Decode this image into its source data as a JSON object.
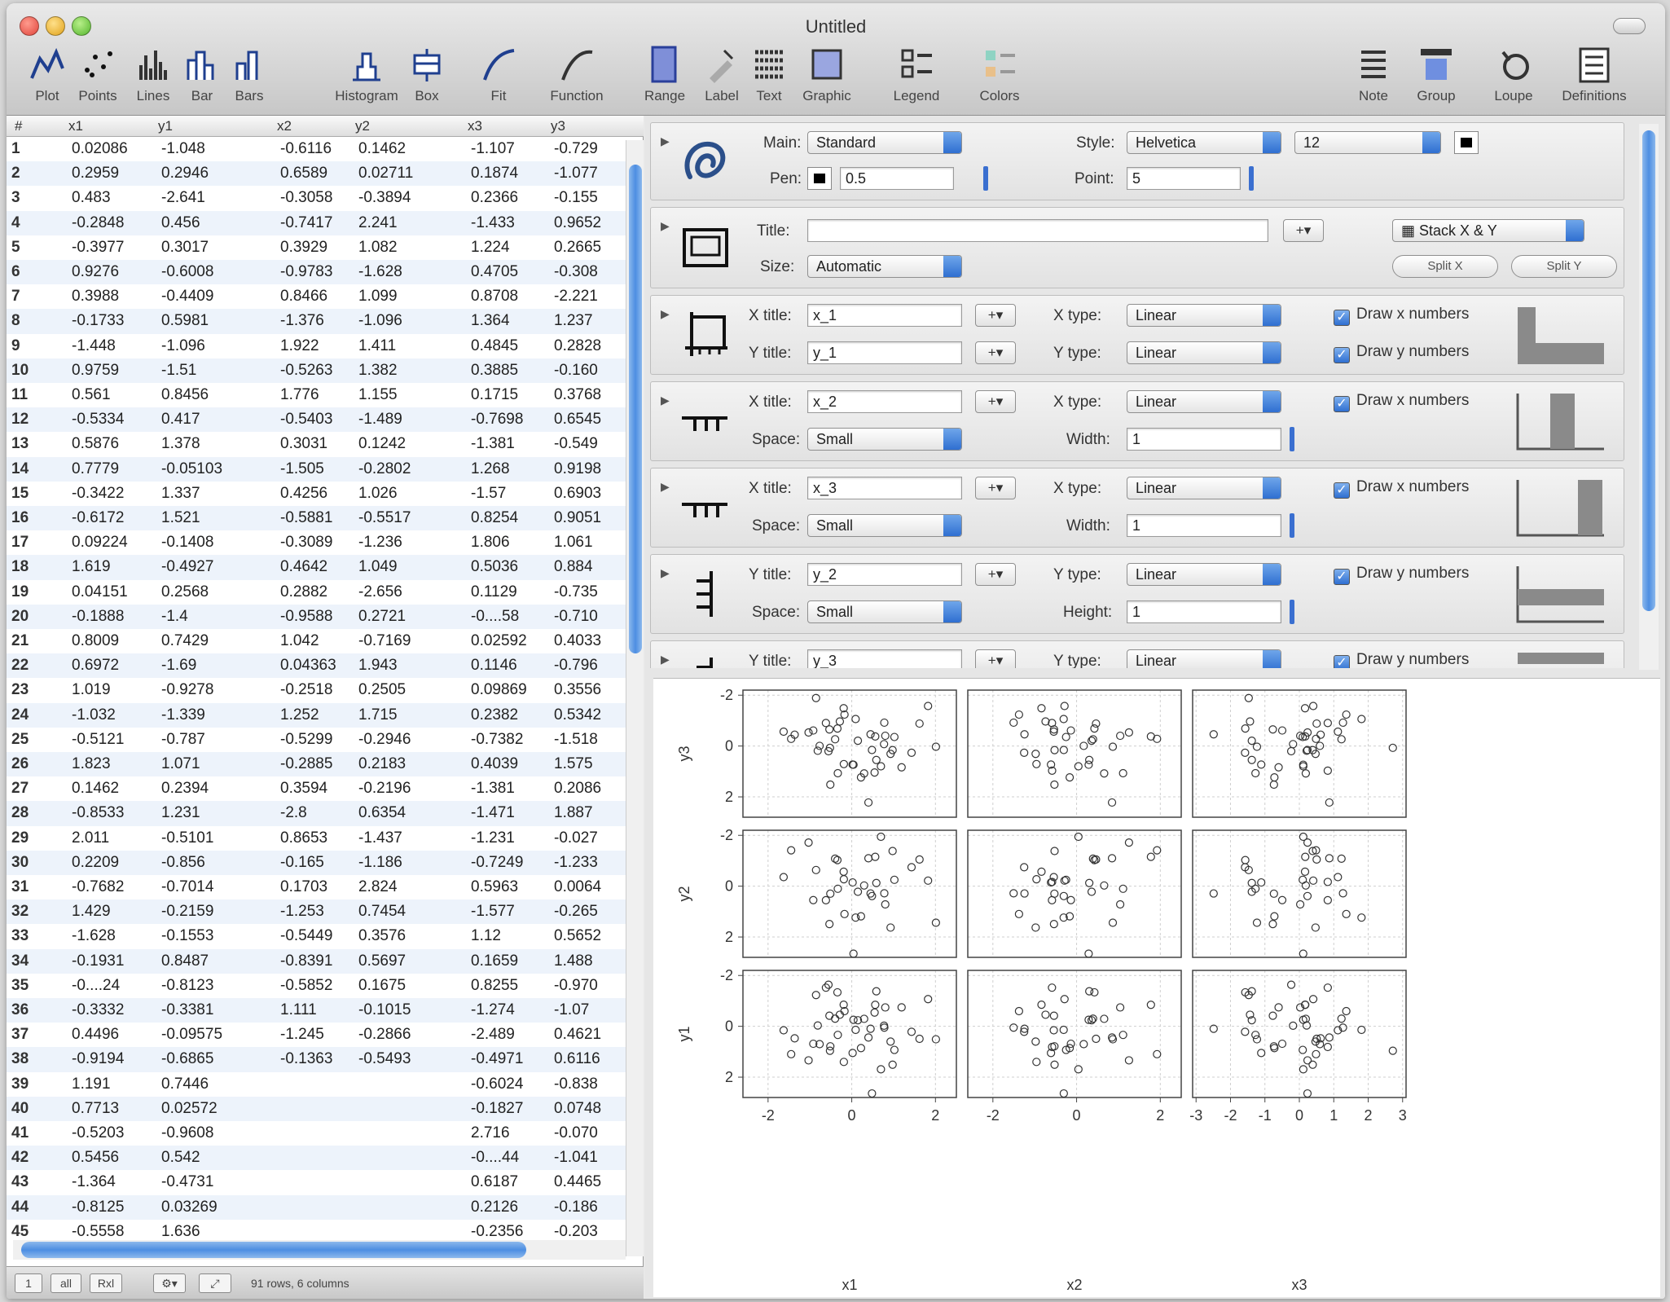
{
  "window": {
    "title": "Untitled"
  },
  "toolbar": [
    {
      "label": "Plot",
      "icon": "plot-icon"
    },
    {
      "label": "Points",
      "icon": "points-icon"
    },
    {
      "label": "Lines",
      "icon": "lines-icon"
    },
    {
      "label": "Bar",
      "icon": "bar-icon"
    },
    {
      "label": "Bars",
      "icon": "bars-icon"
    },
    {
      "label": "Histogram",
      "icon": "histogram-icon"
    },
    {
      "label": "Box",
      "icon": "box-icon"
    },
    {
      "label": "Fit",
      "icon": "fit-icon"
    },
    {
      "label": "Function",
      "icon": "function-icon"
    },
    {
      "label": "Range",
      "icon": "range-icon"
    },
    {
      "label": "Label",
      "icon": "label-icon"
    },
    {
      "label": "Text",
      "icon": "text-icon"
    },
    {
      "label": "Graphic",
      "icon": "graphic-icon"
    },
    {
      "label": "Legend",
      "icon": "legend-icon"
    },
    {
      "label": "Colors",
      "icon": "colors-icon"
    },
    {
      "label": "Note",
      "icon": "note-icon"
    },
    {
      "label": "Group",
      "icon": "group-icon"
    },
    {
      "label": "Loupe",
      "icon": "loupe-icon"
    },
    {
      "label": "Definitions",
      "icon": "definitions-icon"
    }
  ],
  "table": {
    "columns": [
      "#",
      "x1",
      "y1",
      "x2",
      "y2",
      "x3",
      "y3"
    ],
    "rows": [
      [
        "1",
        "0.02086",
        "-1.048",
        "-0.6116",
        "0.1462",
        "-1.107",
        "-0.729"
      ],
      [
        "2",
        "0.2959",
        "0.2946",
        "0.6589",
        "0.02711",
        "0.1874",
        "-1.077"
      ],
      [
        "3",
        "0.483",
        "-2.641",
        "-0.3058",
        "-0.3894",
        "0.2366",
        "-0.155"
      ],
      [
        "4",
        "-0.2848",
        "0.456",
        "-0.7417",
        "2.241",
        "-1.433",
        "0.9652"
      ],
      [
        "5",
        "-0.3977",
        "0.3017",
        "0.3929",
        "1.082",
        "1.224",
        "0.2665"
      ],
      [
        "6",
        "0.9276",
        "-0.6008",
        "-0.9783",
        "-1.628",
        "0.4705",
        "-0.308"
      ],
      [
        "7",
        "0.3988",
        "-0.4409",
        "0.8466",
        "1.099",
        "0.8708",
        "-2.221"
      ],
      [
        "8",
        "-0.1733",
        "0.5981",
        "-1.376",
        "-1.096",
        "1.364",
        "1.237"
      ],
      [
        "9",
        "-1.448",
        "-1.096",
        "1.922",
        "1.411",
        "0.4845",
        "0.2828"
      ],
      [
        "10",
        "0.9759",
        "-1.51",
        "-0.5263",
        "1.382",
        "0.3885",
        "-0.160"
      ],
      [
        "11",
        "0.561",
        "0.8456",
        "1.776",
        "1.155",
        "0.1715",
        "0.3768"
      ],
      [
        "12",
        "-0.5334",
        "0.417",
        "-0.5403",
        "-1.489",
        "-0.7698",
        "0.6545"
      ],
      [
        "13",
        "0.5876",
        "1.378",
        "0.3031",
        "0.1242",
        "-1.381",
        "-0.549"
      ],
      [
        "14",
        "0.7779",
        "-0.05103",
        "-1.505",
        "-0.2802",
        "1.268",
        "0.9198"
      ],
      [
        "15",
        "-0.3422",
        "1.337",
        "0.4256",
        "1.026",
        "-1.57",
        "0.6903"
      ],
      [
        "16",
        "-0.6172",
        "1.521",
        "-0.5881",
        "-0.5517",
        "0.8254",
        "0.9051"
      ],
      [
        "17",
        "0.09224",
        "-0.1408",
        "-0.3089",
        "-1.236",
        "1.806",
        "1.061"
      ],
      [
        "18",
        "1.619",
        "-0.4927",
        "0.4642",
        "1.049",
        "0.5036",
        "0.884"
      ],
      [
        "19",
        "0.04151",
        "0.2568",
        "0.2882",
        "-2.656",
        "0.1129",
        "-0.735"
      ],
      [
        "20",
        "-0.1888",
        "-1.4",
        "-0.9588",
        "0.2721",
        "-0....58",
        "-0.710"
      ],
      [
        "21",
        "0.8009",
        "0.7429",
        "1.042",
        "-0.7169",
        "0.02592",
        "0.4033"
      ],
      [
        "22",
        "0.6972",
        "-1.69",
        "0.04363",
        "1.943",
        "0.1146",
        "-0.796"
      ],
      [
        "23",
        "1.019",
        "-0.9278",
        "-0.2518",
        "0.2505",
        "0.09869",
        "0.3556"
      ],
      [
        "24",
        "-1.032",
        "-1.339",
        "1.252",
        "1.715",
        "0.2382",
        "0.5342"
      ],
      [
        "25",
        "-0.5121",
        "-0.787",
        "-0.5299",
        "-0.2946",
        "-0.7382",
        "-1.518"
      ],
      [
        "26",
        "1.823",
        "1.071",
        "-0.2885",
        "0.2183",
        "0.4039",
        "1.575"
      ],
      [
        "27",
        "0.1462",
        "0.2394",
        "0.3594",
        "-0.2196",
        "-1.381",
        "0.2086"
      ],
      [
        "28",
        "-0.8533",
        "1.231",
        "-2.8",
        "0.6354",
        "-1.471",
        "1.887"
      ],
      [
        "29",
        "2.011",
        "-0.5101",
        "0.8653",
        "-1.437",
        "-1.231",
        "-0.027"
      ],
      [
        "30",
        "0.2209",
        "-0.856",
        "-0.165",
        "-1.186",
        "-0.7249",
        "-1.233"
      ],
      [
        "31",
        "-0.7682",
        "-0.7014",
        "0.1703",
        "2.824",
        "0.5963",
        "0.0064"
      ],
      [
        "32",
        "1.429",
        "-0.2159",
        "-1.253",
        "0.7454",
        "-1.577",
        "-0.265"
      ],
      [
        "33",
        "-1.628",
        "-0.1553",
        "-0.5449",
        "0.3576",
        "1.12",
        "0.5652"
      ],
      [
        "34",
        "-0.1931",
        "0.8487",
        "-0.8391",
        "0.5697",
        "0.1659",
        "1.488"
      ],
      [
        "35",
        "-0....24",
        "-0.8123",
        "-0.5852",
        "0.1675",
        "0.8255",
        "-0.970"
      ],
      [
        "36",
        "-0.3332",
        "-0.3381",
        "1.111",
        "-0.1015",
        "-1.274",
        "-1.07"
      ],
      [
        "37",
        "0.4496",
        "-0.09575",
        "-1.245",
        "-0.2866",
        "-2.489",
        "0.4621"
      ],
      [
        "38",
        "-0.9194",
        "-0.6865",
        "-0.1363",
        "-0.5493",
        "-0.4971",
        "0.6116"
      ],
      [
        "39",
        "1.191",
        "0.7446",
        "",
        "",
        "-0.6024",
        "-0.838"
      ],
      [
        "40",
        "0.7713",
        "0.02572",
        "",
        "",
        "-0.1827",
        "0.0748"
      ],
      [
        "41",
        "-0.5203",
        "-0.9608",
        "",
        "",
        "2.716",
        "-0.070"
      ],
      [
        "42",
        "0.5456",
        "0.542",
        "",
        "",
        "-0....44",
        "-1.041"
      ],
      [
        "43",
        "-1.364",
        "-0.4731",
        "",
        "",
        "0.6187",
        "0.4465"
      ],
      [
        "44",
        "-0.8125",
        "0.03269",
        "",
        "",
        "0.2126",
        "-0.186"
      ],
      [
        "45",
        "-0.5558",
        "1.636",
        "",
        "",
        "-0.2356",
        "-0.203"
      ]
    ]
  },
  "status": {
    "text": "91 rows, 6 columns",
    "buttons": [
      "1",
      "all",
      "Rxl"
    ]
  },
  "panel": {
    "main": {
      "main_label": "Main:",
      "main_value": "Standard",
      "style_label": "Style:",
      "style_value": "Helvetica",
      "size_value": "12",
      "pen_label": "Pen:",
      "pen_value": "0.5",
      "point_label": "Point:",
      "point_value": "5"
    },
    "frame": {
      "title_label": "Title:",
      "title_value": "",
      "plus": "+▾",
      "stack_value": "Stack X & Y",
      "size_label": "Size:",
      "size_value": "Automatic",
      "split_x": "Split X",
      "split_y": "Split Y"
    },
    "sections": [
      {
        "xt_label": "X title:",
        "xt_value": "x_1",
        "yt_label": "Y title:",
        "yt_value": "y_1",
        "xtype_label": "X type:",
        "xtype_value": "Linear",
        "ytype_label": "Y type:",
        "ytype_value": "Linear",
        "chk1": "Draw x numbers",
        "chk2": "Draw y numbers"
      },
      {
        "t_label": "X title:",
        "t_value": "x_2",
        "type_label": "X type:",
        "type_value": "Linear",
        "space_label": "Space:",
        "space_value": "Small",
        "w_label": "Width:",
        "w_value": "1",
        "chk": "Draw x numbers"
      },
      {
        "t_label": "X title:",
        "t_value": "x_3",
        "type_label": "X type:",
        "type_value": "Linear",
        "space_label": "Space:",
        "space_value": "Small",
        "w_label": "Width:",
        "w_value": "1",
        "chk": "Draw x numbers"
      },
      {
        "t_label": "Y title:",
        "t_value": "y_2",
        "type_label": "Y type:",
        "type_value": "Linear",
        "space_label": "Space:",
        "space_value": "Small",
        "w_label": "Height:",
        "w_value": "1",
        "chk": "Draw y numbers"
      },
      {
        "t_label": "Y title:",
        "t_value": "y_3",
        "type_label": "Y type:",
        "type_value": "Linear",
        "chk": "Draw y numbers"
      }
    ]
  },
  "plot": {
    "row_labels": [
      "y3",
      "y2",
      "y1"
    ],
    "col_labels": [
      "x1",
      "x2",
      "x3"
    ],
    "y_ticks": [
      "2",
      "0",
      "-2"
    ],
    "x_ticks": [
      [
        "-2",
        "0",
        "2"
      ],
      [
        "-2",
        "0",
        "2"
      ],
      [
        "-3",
        "-2",
        "-1",
        "0",
        "1",
        "2",
        "3"
      ]
    ]
  },
  "chart_data": {
    "type": "scatter",
    "title": "",
    "layout": "3x3 scatter matrix",
    "rows": [
      "y3",
      "y2",
      "y1"
    ],
    "cols": [
      "x1",
      "x2",
      "x3"
    ],
    "xlim": [
      [
        -2.6,
        2.5
      ],
      [
        -2.6,
        2.5
      ],
      [
        -3.1,
        3.1
      ]
    ],
    "ylim": [
      [
        -2.8,
        2.2
      ],
      [
        -2.8,
        2.2
      ],
      [
        -2.8,
        2.2
      ]
    ],
    "grid": true,
    "y_ticks": [
      -2,
      0,
      2
    ],
    "x_ticks": [
      [
        -2,
        0,
        2
      ],
      [
        -2,
        0,
        2
      ],
      [
        -3,
        -2,
        -1,
        0,
        1,
        2,
        3
      ]
    ]
  }
}
